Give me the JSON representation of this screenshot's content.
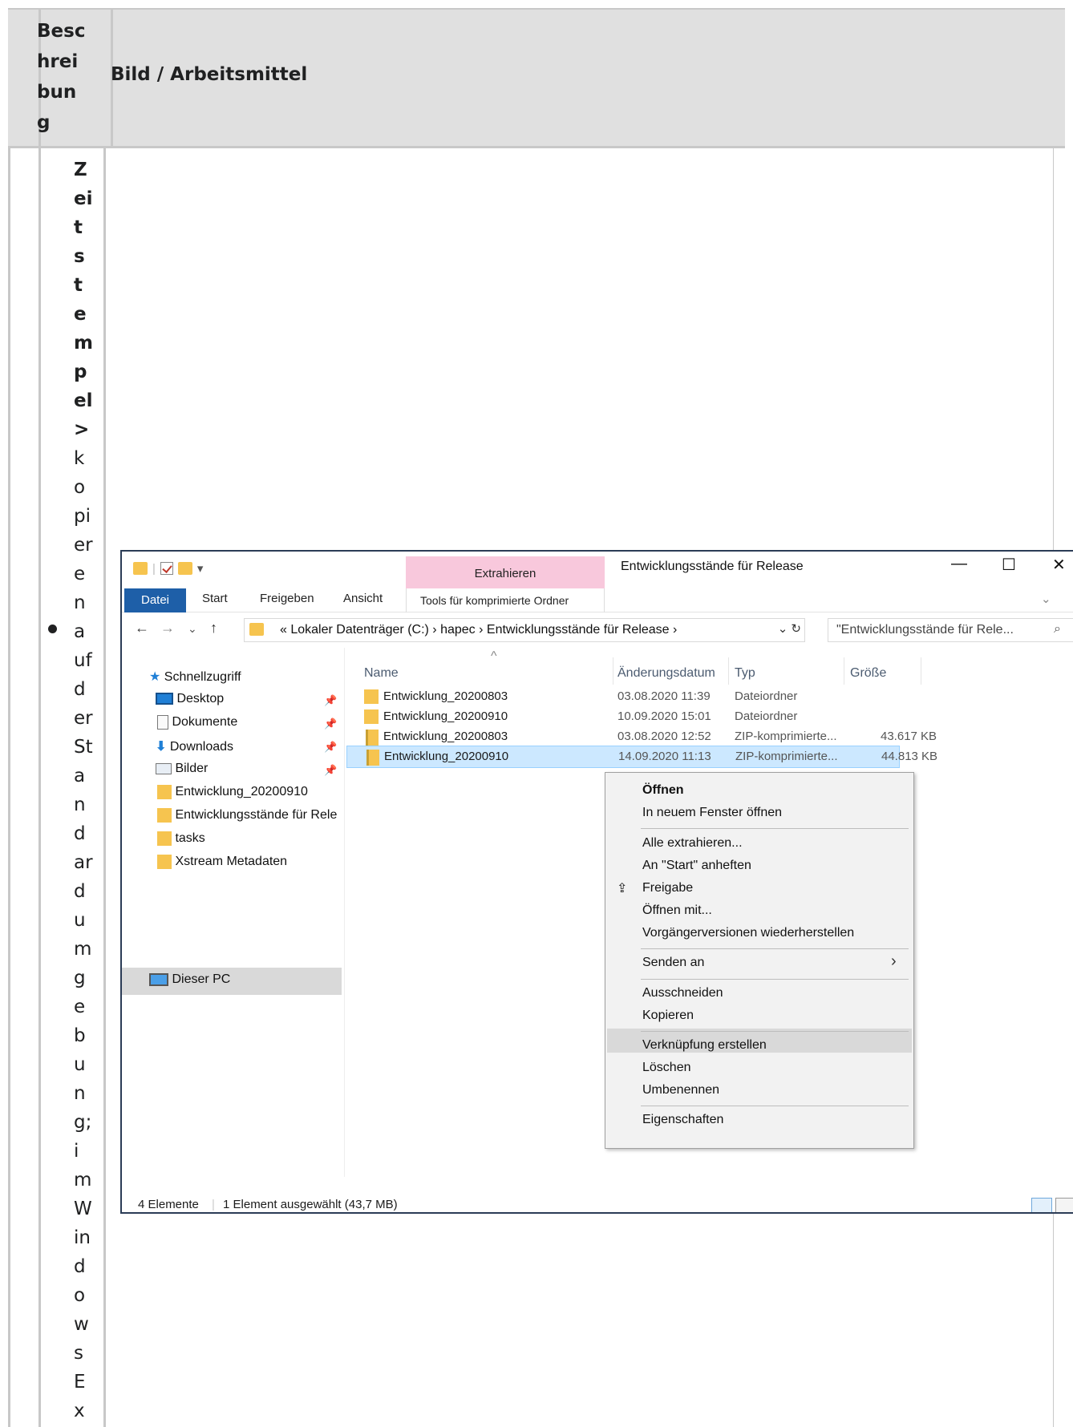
{
  "table": {
    "header_desc": "Beschreibung",
    "header_desc_lines": [
      "Besc",
      "hrei",
      "bun",
      "g"
    ],
    "header_image": "Bild / Arbeitsmittel",
    "description_lines_bold": [
      "Z",
      "ei",
      "t",
      "s",
      "t",
      "e",
      "m",
      "p",
      "el",
      ">"
    ],
    "description_lines": [
      "k",
      "o",
      "pi",
      "er",
      "e",
      "n",
      "a",
      "uf",
      "d",
      "er",
      "St",
      "a",
      "n",
      "d",
      "ar",
      "d",
      "u",
      "m",
      "g",
      "e",
      "b",
      "u",
      "n",
      "g;",
      "i",
      "m",
      "W",
      "in",
      "d",
      "o",
      "w",
      "s",
      "E",
      "x"
    ]
  },
  "explorer": {
    "context_tab": "Extrahieren",
    "window_title": "Entwicklungsstände für Release",
    "window_controls": {
      "minimize": "—",
      "maximize": "☐",
      "close": "✕"
    },
    "ribbon_tabs": {
      "file": "Datei",
      "start": "Start",
      "share": "Freigeben",
      "view": "Ansicht",
      "tools": "Tools für komprimierte Ordner"
    },
    "ribbon_expand": "⌄",
    "nav_buttons": {
      "back": "←",
      "forward": "→",
      "recent": "⌄",
      "up": "↑"
    },
    "address": "« Lokaler Datenträger (C:) › hapec › Entwicklungsstände für Release ›",
    "address_controls": "⌄ ↻",
    "search_placeholder": "\"Entwicklungsstände für Rele...",
    "search_icon": "⌕",
    "nav_pane": {
      "quick_access": "Schnellzugriff",
      "items": [
        "Desktop",
        "Dokumente",
        "Downloads",
        "Bilder",
        "Entwicklung_20200910",
        "Entwicklungsstände für Rele",
        "tasks",
        "Xstream Metadaten"
      ],
      "pin_glyph": "📌",
      "this_pc": "Dieser PC"
    },
    "columns": {
      "name": "Name",
      "date": "Änderungsdatum",
      "type": "Typ",
      "size": "Größe",
      "sort_glyph": "^"
    },
    "files": [
      {
        "name": "Entwicklung_20200803",
        "date": "03.08.2020 11:39",
        "type": "Dateiordner",
        "size": "",
        "icon": "folder-icon"
      },
      {
        "name": "Entwicklung_20200910",
        "date": "10.09.2020 15:01",
        "type": "Dateiordner",
        "size": "",
        "icon": "folder-icon"
      },
      {
        "name": "Entwicklung_20200803",
        "date": "03.08.2020 12:52",
        "type": "ZIP-komprimierte...",
        "size": "43.617 KB",
        "icon": "zip-icon"
      },
      {
        "name": "Entwicklung_20200910",
        "date": "14.09.2020 11:13",
        "type": "ZIP-komprimierte...",
        "size": "44.813 KB",
        "icon": "zip-icon",
        "selected": true
      }
    ],
    "context_menu": {
      "open": "Öffnen",
      "open_new_window": "In neuem Fenster öffnen",
      "extract_all": "Alle extrahieren...",
      "pin_start": "An \"Start\" anheften",
      "share": "Freigabe",
      "open_with": "Öffnen mit...",
      "restore_versions": "Vorgängerversionen wiederherstellen",
      "send_to": "Senden an",
      "cut": "Ausschneiden",
      "copy": "Kopieren",
      "create_shortcut": "Verknüpfung erstellen",
      "delete": "Löschen",
      "rename": "Umbenennen",
      "properties": "Eigenschaften",
      "submenu_glyph": "›",
      "share_glyph": "⇪"
    },
    "status": {
      "count": "4 Elemente",
      "selected": "1 Element ausgewählt (43,7 MB)"
    }
  }
}
